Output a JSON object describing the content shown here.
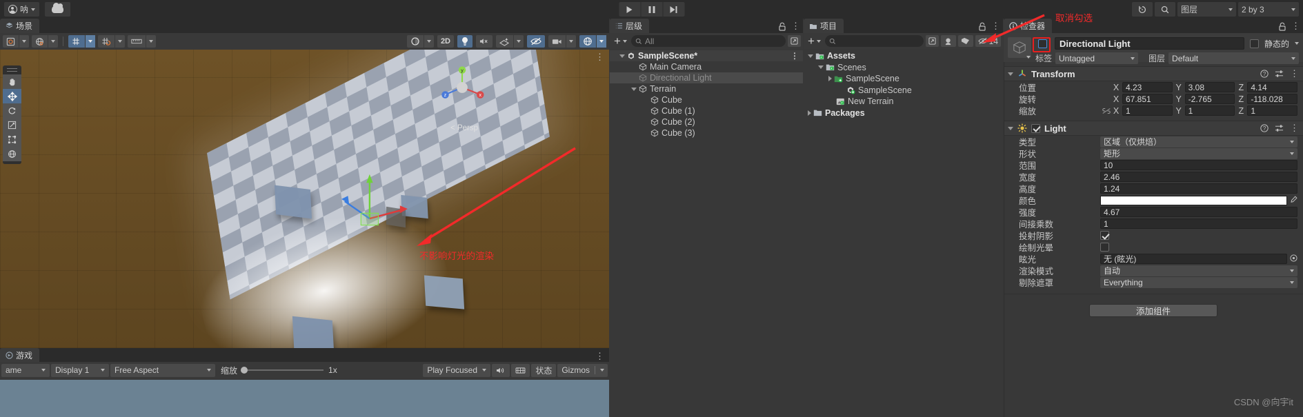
{
  "topbar": {
    "account_label": "呐",
    "cloud_icon": "cloud-icon",
    "undo_icon": "history-icon",
    "search_icon": "search-icon",
    "layers_dropdown": "图层",
    "layout_dropdown": "2 by 3",
    "play_icon": "play-icon",
    "pause_icon": "pause-icon",
    "step_icon": "step-icon"
  },
  "scene": {
    "tab_label": "场景",
    "tab_icon": "scene-icon",
    "toolbar": {
      "pivot_mode": "pivot-icon",
      "handle_space": "global-icon",
      "grid_snap": "grid-snap-icon",
      "grid_vis": "grid-visibility-icon",
      "ruler": "ruler-icon",
      "shading_mode": "shading-icon",
      "two_d_label": "2D",
      "lighting_icon": "lightbulb-icon",
      "audio_icon": "audio-mute-icon",
      "fx_icon": "effects-icon",
      "hidden_icon": "hidden-objects-icon",
      "camera_icon": "camera-icon",
      "gizmos_icon": "gizmos-globe-icon"
    },
    "left_tools": [
      "hand-tool",
      "move-tool",
      "rotate-tool",
      "scale-tool",
      "rect-tool",
      "transform-tool"
    ],
    "persp_label": "< Persp",
    "gizmo_axes": [
      "y",
      "x",
      "z"
    ],
    "annotation_scene": "不影响灯光的渲染",
    "annotation_inspector": "取消勾选"
  },
  "game": {
    "tab_label": "游戏",
    "tab_icon": "game-icon",
    "game_dropdown": "ame",
    "display_dropdown": "Display 1",
    "aspect_dropdown": "Free Aspect",
    "zoom_label": "缩放",
    "zoom_value": "1x",
    "play_focused": "Play Focused",
    "mute_icon": "audio-icon",
    "stats_icon": "stats-icon",
    "stats_label": "状态",
    "gizmos_label": "Gizmos"
  },
  "hierarchy": {
    "tab_label": "层级",
    "tab_icon": "hierarchy-icon",
    "lock_icon": "lock-icon",
    "menu_icon": "kebab-menu-icon",
    "add_label": "+",
    "search_placeholder": "All",
    "items": [
      {
        "label": "SampleScene*",
        "depth": 0,
        "state": "scene",
        "expanded": true,
        "icon": "unity-scene-icon"
      },
      {
        "label": "Main Camera",
        "depth": 1,
        "state": "normal",
        "icon": "gameobject-icon"
      },
      {
        "label": "Directional Light",
        "depth": 1,
        "state": "selected-dim",
        "icon": "gameobject-icon"
      },
      {
        "label": "Terrain",
        "depth": 1,
        "state": "normal",
        "expanded": true,
        "icon": "gameobject-icon"
      },
      {
        "label": "Cube",
        "depth": 2,
        "state": "normal",
        "icon": "gameobject-icon"
      },
      {
        "label": "Cube (1)",
        "depth": 2,
        "state": "normal",
        "icon": "gameobject-icon"
      },
      {
        "label": "Cube (2)",
        "depth": 2,
        "state": "normal",
        "icon": "gameobject-icon"
      },
      {
        "label": "Cube (3)",
        "depth": 2,
        "state": "normal",
        "icon": "gameobject-icon"
      }
    ]
  },
  "project": {
    "tab_label": "项目",
    "tab_icon": "folder-icon",
    "lock_icon": "lock-icon",
    "menu_icon": "kebab-menu-icon",
    "add_label": "+",
    "search_placeholder": "",
    "save_icon": "save-icon",
    "tag_icon": "label-icon",
    "hidden_count": "14",
    "hidden_icon": "hidden-icon",
    "items": [
      {
        "label": "Assets",
        "depth": 0,
        "expanded": true,
        "bold": true,
        "icon": "folder-asset-icon"
      },
      {
        "label": "Scenes",
        "depth": 1,
        "expanded": true,
        "bold": false,
        "icon": "folder-asset-icon"
      },
      {
        "label": "SampleScene",
        "depth": 2,
        "collapsed": true,
        "bold": false,
        "icon": "folder-scene-icon"
      },
      {
        "label": "SampleScene",
        "depth": 3,
        "bold": false,
        "icon": "unity-scene-icon"
      },
      {
        "label": "New Terrain",
        "depth": 2,
        "bold": false,
        "icon": "terrain-asset-icon"
      },
      {
        "label": "Packages",
        "depth": 0,
        "collapsed": true,
        "bold": true,
        "icon": "folder-icon"
      }
    ]
  },
  "inspector": {
    "tab_label": "检查器",
    "tab_icon": "info-icon",
    "lock_icon": "lock-icon",
    "menu_icon": "kebab-menu-icon",
    "object_name": "Directional Light",
    "object_enabled": false,
    "static_label": "静态的",
    "static_checked": false,
    "tag_label": "标签",
    "tag_value": "Untagged",
    "layer_label": "图层",
    "layer_value": "Default",
    "transform": {
      "title": "Transform",
      "icon": "transform-icon",
      "help_icon": "help-icon",
      "preset_icon": "preset-icon",
      "menu_icon": "kebab-menu-icon",
      "rows": [
        {
          "label": "位置",
          "x": "4.23",
          "y": "3.08",
          "z": "4.14"
        },
        {
          "label": "旋转",
          "x": "67.851",
          "y": "-2.765",
          "z": "-118.028"
        },
        {
          "label": "缩放",
          "x": "1",
          "y": "1",
          "z": "1",
          "link_icon": "unlink-icon"
        }
      ],
      "axis_labels": [
        "X",
        "Y",
        "Z"
      ]
    },
    "light": {
      "title": "Light",
      "icon": "light-icon",
      "enabled": true,
      "help_icon": "help-icon",
      "preset_icon": "preset-icon",
      "menu_icon": "kebab-menu-icon",
      "fields": [
        {
          "label": "类型",
          "value": "区域（仅烘焙）",
          "kind": "dropdown"
        },
        {
          "label": "形状",
          "value": "矩形",
          "kind": "dropdown"
        },
        {
          "label": "范围",
          "value": "10",
          "kind": "text"
        },
        {
          "label": "宽度",
          "value": "2.46",
          "kind": "text"
        },
        {
          "label": "高度",
          "value": "1.24",
          "kind": "text"
        },
        {
          "label": "颜色",
          "value": "#FFFFFF",
          "kind": "color"
        },
        {
          "label": "强度",
          "value": "4.67",
          "kind": "text"
        },
        {
          "label": "间接乘数",
          "value": "1",
          "kind": "text"
        },
        {
          "label": "投射阴影",
          "value": true,
          "kind": "checkbox"
        },
        {
          "label": "绘制光晕",
          "value": false,
          "kind": "checkbox"
        },
        {
          "label": "眩光",
          "value": "无 (眩光)",
          "kind": "object"
        },
        {
          "label": "渲染模式",
          "value": "自动",
          "kind": "dropdown"
        },
        {
          "label": "剔除遮罩",
          "value": "Everything",
          "kind": "dropdown"
        }
      ]
    },
    "add_component_label": "添加组件",
    "watermark": "CSDN @向宇it"
  }
}
